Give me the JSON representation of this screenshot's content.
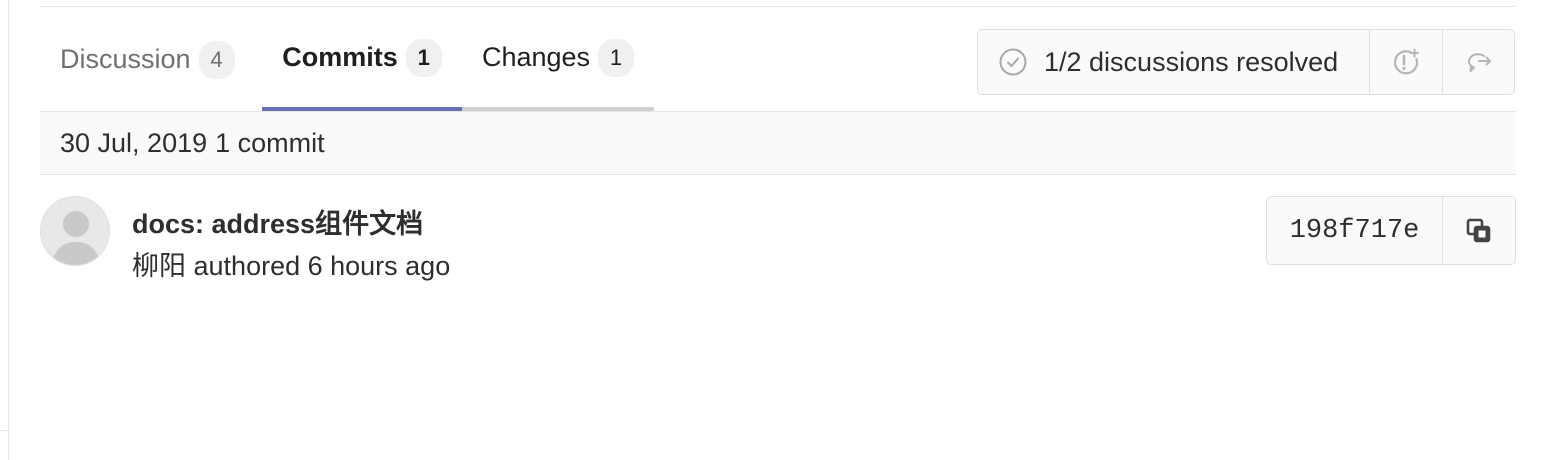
{
  "tabs": [
    {
      "label": "Discussion",
      "count": "4",
      "active": false
    },
    {
      "label": "Commits",
      "count": "1",
      "active": true
    },
    {
      "label": "Changes",
      "count": "1",
      "active": false
    }
  ],
  "discussions": {
    "status_text": "1/2 discussions resolved",
    "icons": {
      "status": "check-circle-icon",
      "jump": "jump-to-unresolved-icon",
      "resolve": "reply-forward-icon"
    }
  },
  "day_header": {
    "date": "30 Jul, 2019",
    "count_text": "1 commit"
  },
  "commit": {
    "title": "docs: address组件文档",
    "author": "柳阳",
    "authored_text": "authored 6 hours ago",
    "sha": "198f717e",
    "icons": {
      "avatar": "default-avatar-icon",
      "copy": "copy-icon"
    }
  },
  "colors": {
    "active_tab_underline": "#6b6fb8",
    "inactive_tab_underline": "#cfcfcf",
    "header_background": "#fafafa",
    "border": "#e5e5e5"
  }
}
